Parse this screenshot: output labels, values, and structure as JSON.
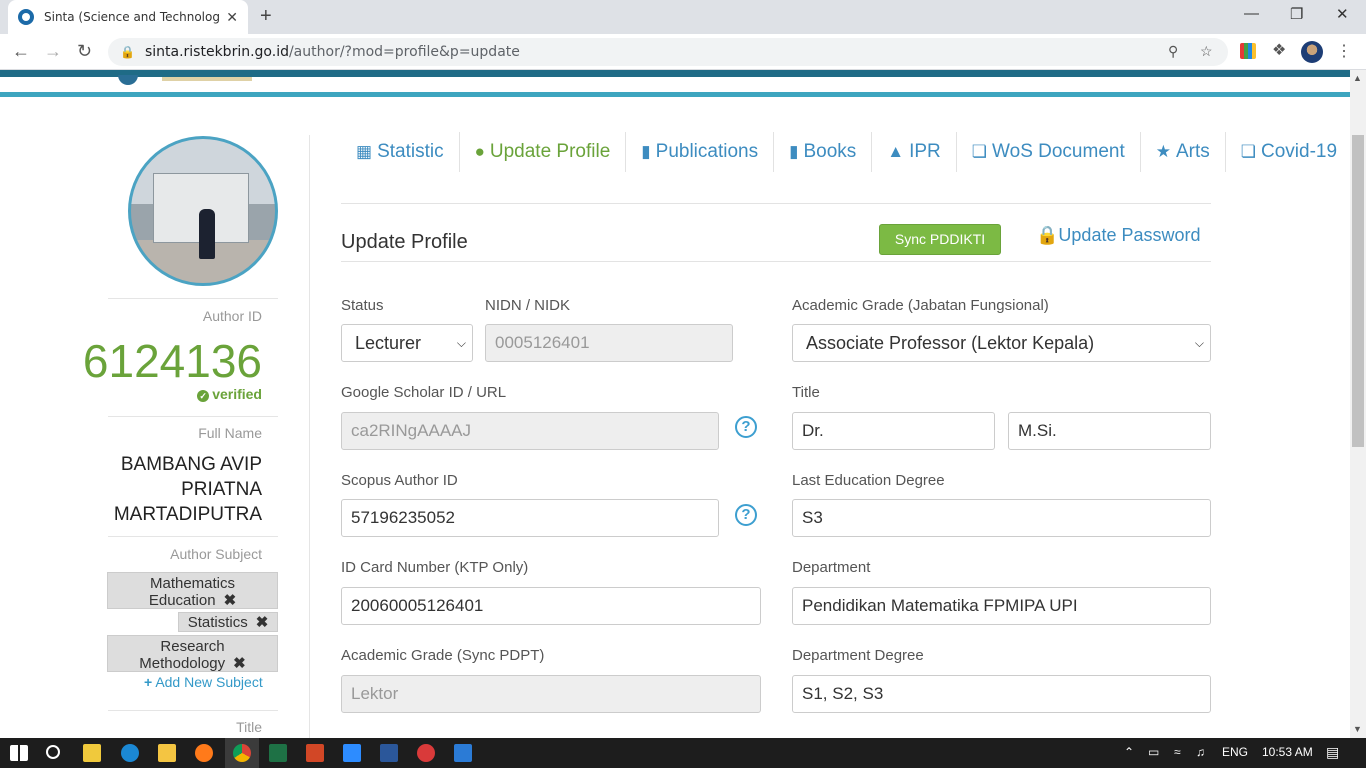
{
  "browser": {
    "tab_title": "Sinta (Science and Technology In",
    "tab_close": "✕",
    "new_tab": "+",
    "url_host": "sinta.ristekbrin.go.id",
    "url_path": "/author/?mod=profile&p=update",
    "win_minimize": "—",
    "win_restore": "❐",
    "win_close": "✕"
  },
  "sidebar": {
    "author_id_label": "Author ID",
    "author_id": "6124136",
    "verified": "verified",
    "full_name_label": "Full Name",
    "full_name": "BAMBANG AVIP PRIATNA MARTADIPUTRA",
    "author_subject_label": "Author Subject",
    "subjects": [
      "Mathematics Education",
      "Statistics",
      "Research Methodology"
    ],
    "add_subject": "Add New Subject",
    "title_label": "Title"
  },
  "nav": {
    "tabs": [
      {
        "label": "Statistic",
        "icon": "bar-chart-icon"
      },
      {
        "label": "Update Profile",
        "icon": "user-icon"
      },
      {
        "label": "Publications",
        "icon": "book-icon"
      },
      {
        "label": "Books",
        "icon": "book-icon"
      },
      {
        "label": "IPR",
        "icon": "trophy-icon"
      },
      {
        "label": "WoS Document",
        "icon": "copy-icon"
      },
      {
        "label": "Arts",
        "icon": "star-icon"
      },
      {
        "label": "Covid-19",
        "icon": "copy-icon"
      }
    ]
  },
  "form": {
    "section_title": "Update Profile",
    "sync_button": "Sync PDDIKTI",
    "update_password": "Update Password",
    "status_label": "Status",
    "status_value": "Lecturer",
    "nidn_label": "NIDN / NIDK",
    "nidn_value": "0005126401",
    "academic_grade_label": "Academic Grade (Jabatan Fungsional)",
    "academic_grade_value": "Associate Professor (Lektor Kepala)",
    "scholar_label": "Google Scholar ID / URL",
    "scholar_value": "ca2RINgAAAAJ",
    "title_label": "Title",
    "title_front": "Dr.",
    "title_back": "M.Si.",
    "scopus_label": "Scopus Author ID",
    "scopus_value": "57196235052",
    "last_edu_label": "Last Education Degree",
    "last_edu_value": "S3",
    "ktp_label": "ID Card Number (KTP Only)",
    "ktp_value": "20060005126401",
    "department_label": "Department",
    "department_value": "Pendidikan Matematika FPMIPA UPI",
    "grade_pdpt_label": "Academic Grade (Sync PDPT)",
    "grade_pdpt_value": "Lektor",
    "dept_degree_label": "Department Degree",
    "dept_degree_value": "S1, S2, S3",
    "help": "?"
  },
  "taskbar": {
    "lang": "ENG",
    "time": "10:53 AM"
  }
}
